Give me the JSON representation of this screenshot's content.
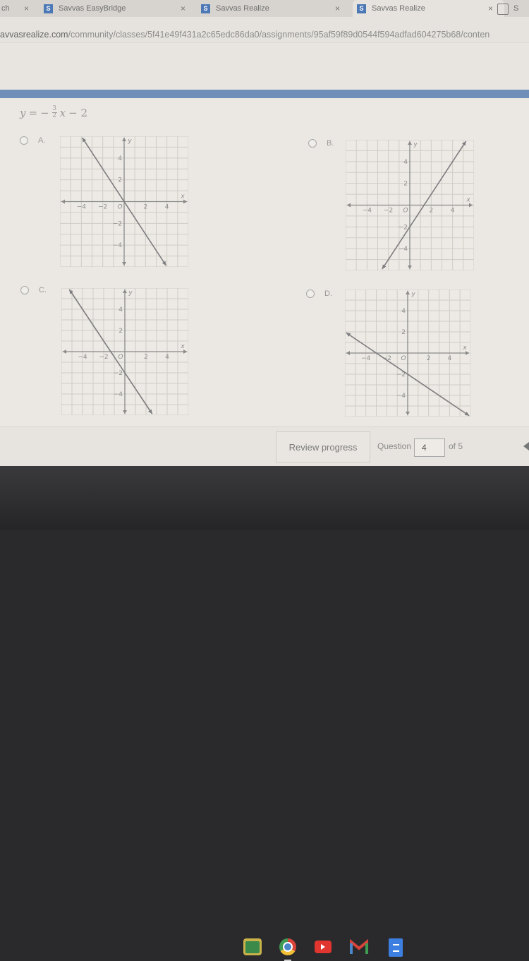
{
  "browser": {
    "tabs": [
      {
        "label": "ch",
        "active": false
      },
      {
        "label": "Savvas EasyBridge",
        "active": false
      },
      {
        "label": "Savvas Realize",
        "active": false
      },
      {
        "label": "Savvas Realize",
        "active": true
      },
      {
        "label": "S",
        "active": false
      }
    ],
    "close_glyph": "×",
    "favicon_glyph": "S",
    "url_domain": "avvasrealize.com",
    "url_path": "/community/classes/5f41e49f431a2c65edc86da0/assignments/95af59f89d0544f594adfad604275b68/conten"
  },
  "question": {
    "equation": {
      "lhs": "y",
      "eq": "=",
      "sign": "−",
      "num": "3",
      "den": "2",
      "var": "x",
      "tail": "− 2"
    },
    "options": [
      {
        "letter": "A.",
        "selected": false
      },
      {
        "letter": "B.",
        "selected": false
      },
      {
        "letter": "C.",
        "selected": false
      },
      {
        "letter": "D.",
        "selected": false
      }
    ]
  },
  "chart_data": [
    {
      "type": "line",
      "option": "A",
      "xlabel": "x",
      "ylabel": "y",
      "origin_label": "O",
      "xlim": [
        -6,
        6
      ],
      "ylim": [
        -6,
        6
      ],
      "grid": true,
      "xticks": [
        -4,
        -2,
        2,
        4
      ],
      "yticks": [
        4,
        2,
        -2,
        -4
      ],
      "tick_labels_x": [
        "−4",
        "−2",
        "2",
        "4"
      ],
      "tick_labels_y": [
        "4",
        "2",
        "−2",
        "−4"
      ],
      "line": {
        "slope": -1.5,
        "intercept": 0
      }
    },
    {
      "type": "line",
      "option": "B",
      "xlabel": "x",
      "ylabel": "y",
      "origin_label": "O",
      "xlim": [
        -6,
        6
      ],
      "ylim": [
        -6,
        6
      ],
      "grid": true,
      "xticks": [
        -4,
        -2,
        2,
        4
      ],
      "yticks": [
        4,
        2,
        -2,
        -4
      ],
      "tick_labels_x": [
        "−4",
        "−2",
        "2",
        "4"
      ],
      "tick_labels_y": [
        "4",
        "2",
        "−2",
        "−4"
      ],
      "line": {
        "slope": 1.5,
        "intercept": -2
      }
    },
    {
      "type": "line",
      "option": "C",
      "xlabel": "x",
      "ylabel": "y",
      "origin_label": "O",
      "xlim": [
        -6,
        6
      ],
      "ylim": [
        -6,
        6
      ],
      "grid": true,
      "xticks": [
        -4,
        -2,
        2,
        4
      ],
      "yticks": [
        4,
        2,
        -2,
        -4
      ],
      "tick_labels_x": [
        "−4",
        "−2",
        "2",
        "4"
      ],
      "tick_labels_y": [
        "4",
        "2",
        "−2",
        "−4"
      ],
      "line": {
        "slope": -1.5,
        "intercept": -2
      }
    },
    {
      "type": "line",
      "option": "D",
      "xlabel": "x",
      "ylabel": "y",
      "origin_label": "O",
      "xlim": [
        -6,
        6
      ],
      "ylim": [
        -6,
        6
      ],
      "grid": true,
      "xticks": [
        -4,
        -2,
        2,
        4
      ],
      "yticks": [
        4,
        2,
        -2,
        -4
      ],
      "tick_labels_x": [
        "−4",
        "−2",
        "2",
        "4"
      ],
      "tick_labels_y": [
        "4",
        "2",
        "−2",
        "−4"
      ],
      "line": {
        "slope": -0.6667,
        "intercept": -2
      }
    }
  ],
  "footer": {
    "review_label": "Review progress",
    "question_label": "Question",
    "question_value": "4",
    "of_label": "of 5"
  },
  "shelf": {
    "apps": [
      {
        "name": "Google Classroom",
        "icon": "classroom-icon",
        "color": "#3c8a4a"
      },
      {
        "name": "Chrome",
        "icon": "chrome-icon",
        "color": "#4a86c8"
      },
      {
        "name": "YouTube",
        "icon": "youtube-icon",
        "color": "#e0362f"
      },
      {
        "name": "Gmail",
        "icon": "gmail-icon",
        "color": "#d9443a"
      },
      {
        "name": "Google Docs",
        "icon": "docs-icon",
        "color": "#3d7fe0"
      }
    ]
  }
}
